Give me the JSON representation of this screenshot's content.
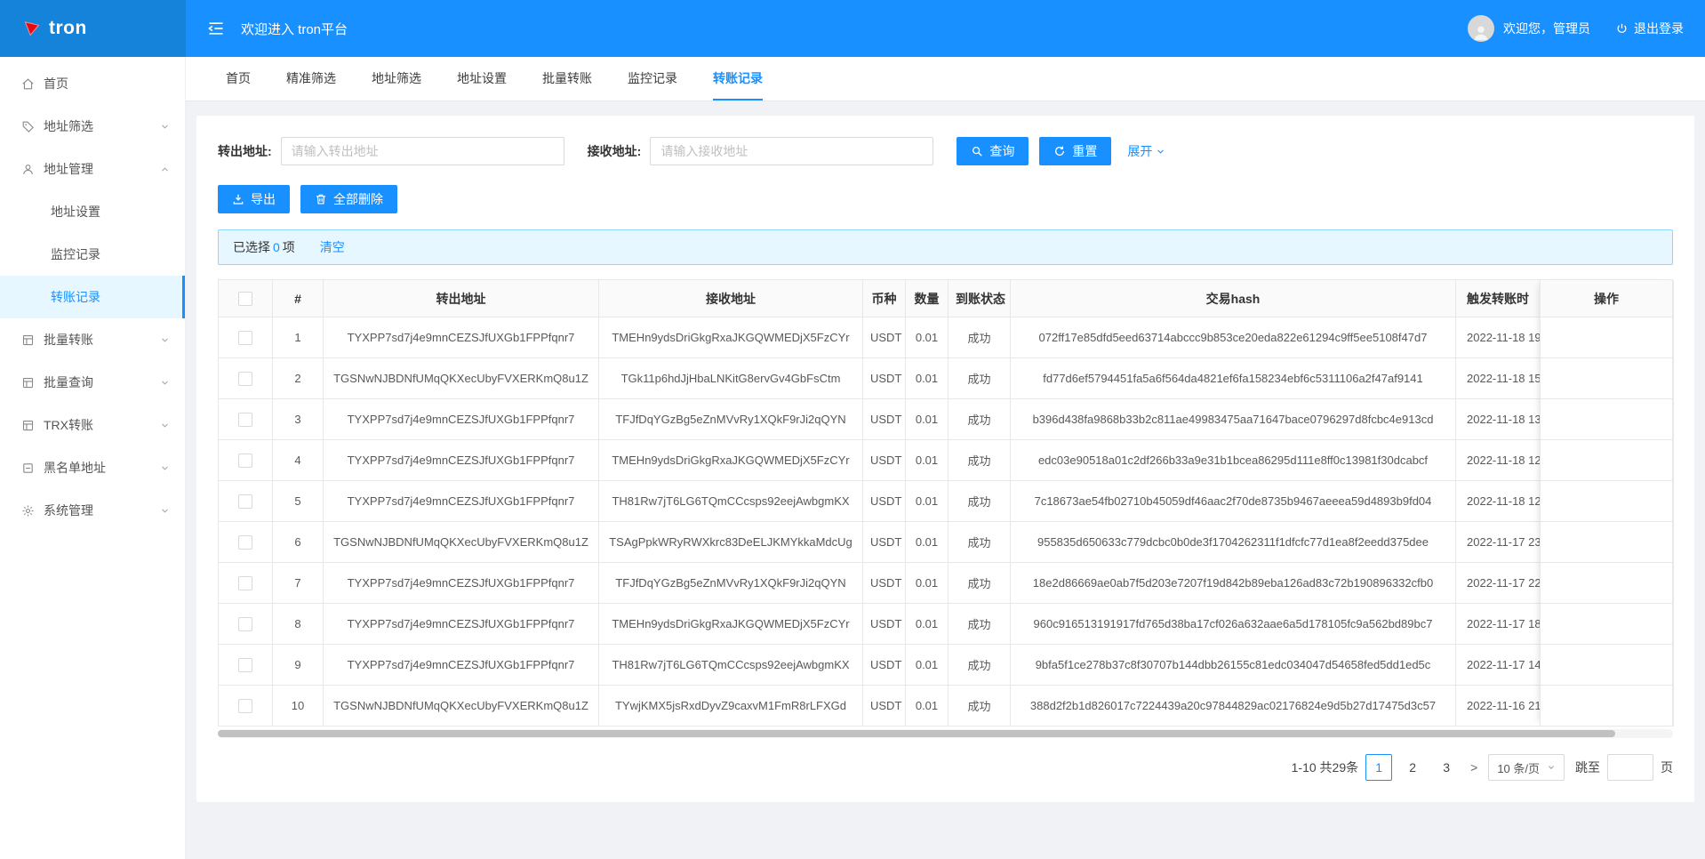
{
  "header": {
    "logo_text": "tron",
    "welcome": "欢迎进入 tron平台",
    "greeting": "欢迎您，管理员",
    "logout_label": "退出登录"
  },
  "sidebar": {
    "items": [
      {
        "key": "home",
        "label": "首页",
        "icon": "home"
      },
      {
        "key": "address-filter",
        "label": "地址筛选",
        "icon": "tag",
        "chevron": "down"
      },
      {
        "key": "address-manage",
        "label": "地址管理",
        "icon": "user",
        "chevron": "up",
        "open": true,
        "children": [
          {
            "key": "address-setting",
            "label": "地址设置"
          },
          {
            "key": "monitor-record",
            "label": "监控记录"
          },
          {
            "key": "transfer-record",
            "label": "转账记录",
            "active": true
          }
        ]
      },
      {
        "key": "batch-transfer",
        "label": "批量转账",
        "icon": "grid",
        "chevron": "down"
      },
      {
        "key": "batch-query",
        "label": "批量查询",
        "icon": "grid",
        "chevron": "down"
      },
      {
        "key": "trx-transfer",
        "label": "TRX转账",
        "icon": "grid",
        "chevron": "down"
      },
      {
        "key": "blacklist-address",
        "label": "黑名单地址",
        "icon": "square",
        "chevron": "down"
      },
      {
        "key": "system-manage",
        "label": "系统管理",
        "icon": "gear",
        "chevron": "down"
      }
    ]
  },
  "tabs": {
    "active": "transfer-record",
    "items": [
      {
        "key": "home",
        "label": "首页"
      },
      {
        "key": "precise-filter",
        "label": "精准筛选"
      },
      {
        "key": "address-filter",
        "label": "地址筛选"
      },
      {
        "key": "address-setting",
        "label": "地址设置"
      },
      {
        "key": "batch-transfer",
        "label": "批量转账"
      },
      {
        "key": "monitor-record",
        "label": "监控记录"
      },
      {
        "key": "transfer-record",
        "label": "转账记录"
      }
    ]
  },
  "filters": {
    "from_label": "转出地址:",
    "from_placeholder": "请输入转出地址",
    "to_label": "接收地址:",
    "to_placeholder": "请输入接收地址",
    "search_label": "查询",
    "reset_label": "重置",
    "expand_label": "展开"
  },
  "actions": {
    "export_label": "导出",
    "delete_all_label": "全部删除"
  },
  "selection": {
    "label": "已选择",
    "count": "0",
    "unit": "项",
    "clear_label": "清空"
  },
  "table": {
    "columns": [
      {
        "key": "index",
        "label": "#"
      },
      {
        "key": "from",
        "label": "转出地址"
      },
      {
        "key": "to",
        "label": "接收地址"
      },
      {
        "key": "coin",
        "label": "币种"
      },
      {
        "key": "amount",
        "label": "数量"
      },
      {
        "key": "status",
        "label": "到账状态"
      },
      {
        "key": "hash",
        "label": "交易hash"
      },
      {
        "key": "time",
        "label": "触发转账时"
      }
    ],
    "op_label": "操作",
    "rows": [
      {
        "index": "1",
        "from": "TYXPP7sd7j4e9mnCEZSJfUXGb1FPPfqnr7",
        "to": "TMEHn9ydsDriGkgRxaJKGQWMEDjX5FzCYr",
        "coin": "USDT",
        "amount": "0.01",
        "status": "成功",
        "hash": "072ff17e85dfd5eed63714abccc9b853ce20eda822e61294c9ff5ee5108f47d7",
        "time": "2022-11-18 19"
      },
      {
        "index": "2",
        "from": "TGSNwNJBDNfUMqQKXecUbyFVXERKmQ8u1Z",
        "to": "TGk11p6hdJjHbaLNKitG8ervGv4GbFsCtm",
        "coin": "USDT",
        "amount": "0.01",
        "status": "成功",
        "hash": "fd77d6ef5794451fa5a6f564da4821ef6fa158234ebf6c5311106a2f47af9141",
        "time": "2022-11-18 15"
      },
      {
        "index": "3",
        "from": "TYXPP7sd7j4e9mnCEZSJfUXGb1FPPfqnr7",
        "to": "TFJfDqYGzBg5eZnMVvRy1XQkF9rJi2qQYN",
        "coin": "USDT",
        "amount": "0.01",
        "status": "成功",
        "hash": "b396d438fa9868b33b2c811ae49983475aa71647bace0796297d8fcbc4e913cd",
        "time": "2022-11-18 13"
      },
      {
        "index": "4",
        "from": "TYXPP7sd7j4e9mnCEZSJfUXGb1FPPfqnr7",
        "to": "TMEHn9ydsDriGkgRxaJKGQWMEDjX5FzCYr",
        "coin": "USDT",
        "amount": "0.01",
        "status": "成功",
        "hash": "edc03e90518a01c2df266b33a9e31b1bcea86295d111e8ff0c13981f30dcabcf",
        "time": "2022-11-18 12"
      },
      {
        "index": "5",
        "from": "TYXPP7sd7j4e9mnCEZSJfUXGb1FPPfqnr7",
        "to": "TH81Rw7jT6LG6TQmCCcsps92eejAwbgmKX",
        "coin": "USDT",
        "amount": "0.01",
        "status": "成功",
        "hash": "7c18673ae54fb02710b45059df46aac2f70de8735b9467aeeea59d4893b9fd04",
        "time": "2022-11-18 12"
      },
      {
        "index": "6",
        "from": "TGSNwNJBDNfUMqQKXecUbyFVXERKmQ8u1Z",
        "to": "TSAgPpkWRyRWXkrc83DeELJKMYkkaMdcUg",
        "coin": "USDT",
        "amount": "0.01",
        "status": "成功",
        "hash": "955835d650633c779dcbc0b0de3f1704262311f1dfcfc77d1ea8f2eedd375dee",
        "time": "2022-11-17 23"
      },
      {
        "index": "7",
        "from": "TYXPP7sd7j4e9mnCEZSJfUXGb1FPPfqnr7",
        "to": "TFJfDqYGzBg5eZnMVvRy1XQkF9rJi2qQYN",
        "coin": "USDT",
        "amount": "0.01",
        "status": "成功",
        "hash": "18e2d86669ae0ab7f5d203e7207f19d842b89eba126ad83c72b190896332cfb0",
        "time": "2022-11-17 22"
      },
      {
        "index": "8",
        "from": "TYXPP7sd7j4e9mnCEZSJfUXGb1FPPfqnr7",
        "to": "TMEHn9ydsDriGkgRxaJKGQWMEDjX5FzCYr",
        "coin": "USDT",
        "amount": "0.01",
        "status": "成功",
        "hash": "960c916513191917fd765d38ba17cf026a632aae6a5d178105fc9a562bd89bc7",
        "time": "2022-11-17 18"
      },
      {
        "index": "9",
        "from": "TYXPP7sd7j4e9mnCEZSJfUXGb1FPPfqnr7",
        "to": "TH81Rw7jT6LG6TQmCCcsps92eejAwbgmKX",
        "coin": "USDT",
        "amount": "0.01",
        "status": "成功",
        "hash": "9bfa5f1ce278b37c8f30707b144dbb26155c81edc034047d54658fed5dd1ed5c",
        "time": "2022-11-17 14"
      },
      {
        "index": "10",
        "from": "TGSNwNJBDNfUMqQKXecUbyFVXERKmQ8u1Z",
        "to": "TYwjKMX5jsRxdDyvZ9caxvM1FmR8rLFXGd",
        "coin": "USDT",
        "amount": "0.01",
        "status": "成功",
        "hash": "388d2f2b1d826017c7224439a20c97844829ac02176824e9d5b27d17475d3c57",
        "time": "2022-11-16 21"
      }
    ]
  },
  "pagination": {
    "total_text": "1-10 共29条",
    "pages": [
      "1",
      "2",
      "3"
    ],
    "active_page": "1",
    "next_label": ">",
    "page_size_label": "10 条/页",
    "jump_label": "跳至",
    "jump_unit": "页"
  },
  "colors": {
    "primary": "#1890ff",
    "header_bg": "#1890ff",
    "logo_bg": "#1583d9",
    "alert_bg": "#e6f7ff",
    "alert_border": "#91d5ff",
    "active_menu_bg": "#e6f7ff"
  },
  "icon_names": [
    "tron-logo-icon",
    "menu-fold-icon",
    "avatar-icon",
    "power-icon",
    "home-icon",
    "tag-icon",
    "user-icon",
    "grid-icon",
    "square-icon",
    "gear-icon",
    "chevron-down-icon",
    "chevron-up-icon",
    "search-icon",
    "reload-icon",
    "download-icon",
    "trash-icon"
  ]
}
